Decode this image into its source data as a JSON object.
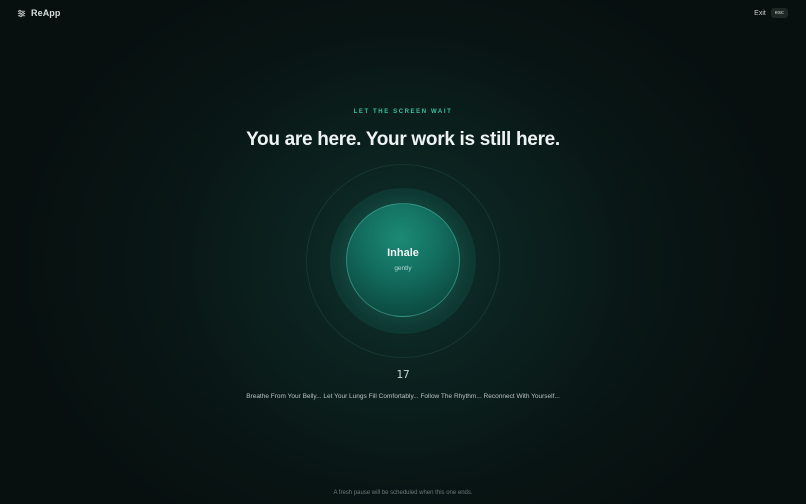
{
  "app": {
    "name": "ReApp",
    "logo_icon": "tune-icon"
  },
  "topbar": {
    "exit_label": "Exit",
    "exit_key": "esc"
  },
  "session": {
    "eyebrow": "LET THE SCREEN WAIT",
    "headline": "You are here. Your work is still here.",
    "phase": "Inhale",
    "phase_hint": "gently",
    "countdown": "17",
    "guidance": "Breathe From Your Belly... Let Your Lungs Fill Comfortably... Follow The Rhythm... Reconnect With Yourself...",
    "footer_note": "A fresh pause will be scheduled when this one ends."
  },
  "colors": {
    "accent": "#35c3a0",
    "orb": "#136e5f",
    "background": "#07100f"
  }
}
